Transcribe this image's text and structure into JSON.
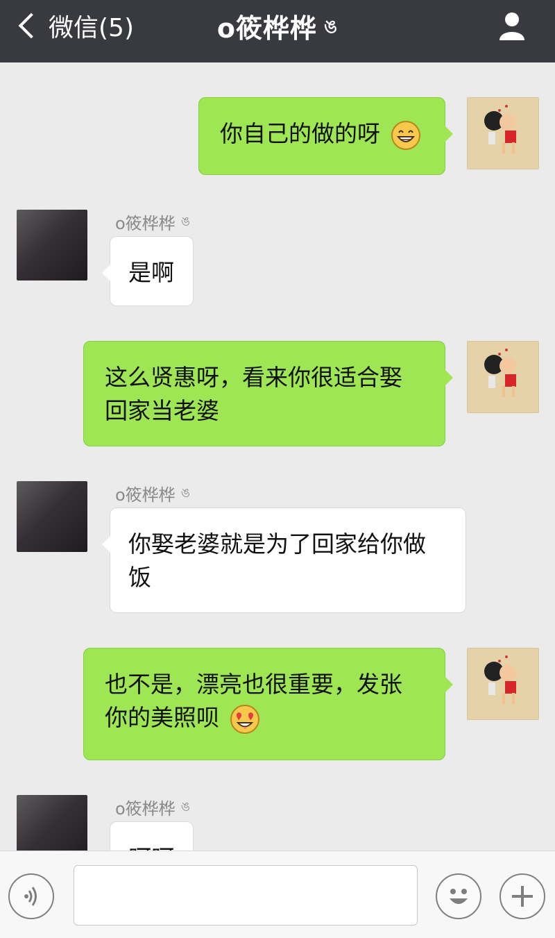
{
  "header": {
    "back_label": "微信(5)",
    "title": "o筱桦桦",
    "title_mark": "ঙ"
  },
  "chat": {
    "sender_name": "o筱桦桦",
    "sender_mark": "ঙ",
    "messages": [
      {
        "side": "right",
        "text": "你自己的做的呀",
        "emoji": "grinning-face-emoji"
      },
      {
        "side": "left",
        "text": "是啊"
      },
      {
        "side": "right",
        "text": "这么贤惠呀，看来你很适合娶回家当老婆"
      },
      {
        "side": "left",
        "text": "你娶老婆就是为了回家给你做饭"
      },
      {
        "side": "right",
        "text": "也不是，漂亮也很重要，发张你的美照呗",
        "emoji": "heart-eyes-emoji"
      },
      {
        "side": "left",
        "text": "呵呵"
      }
    ]
  },
  "bottom": {
    "input_value": "",
    "voice_icon": "voice-icon",
    "emoji_icon": "smile-icon",
    "more_icon": "plus-icon"
  }
}
